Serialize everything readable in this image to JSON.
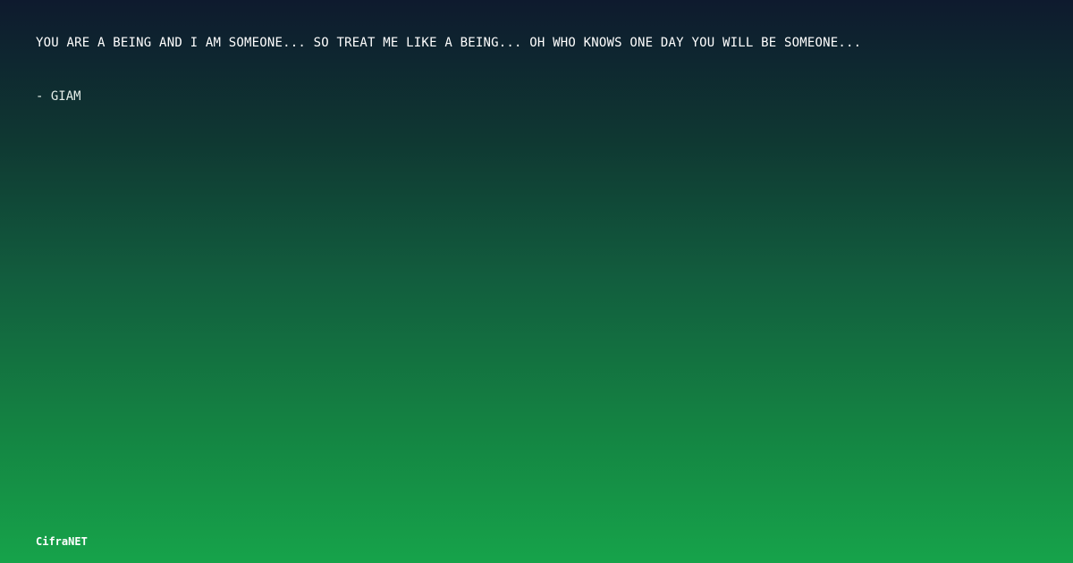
{
  "quote": {
    "text": "YOU ARE A BEING AND I AM SOMEONE... SO TREAT ME LIKE A BEING... OH WHO KNOWS ONE DAY YOU WILL BE SOMEONE...",
    "author": "- GIAM"
  },
  "brand": {
    "name": "CifraNET"
  },
  "colors": {
    "gradient_top": "#0e1a2e",
    "gradient_bottom": "#16a34a",
    "text": "#ffffff"
  }
}
